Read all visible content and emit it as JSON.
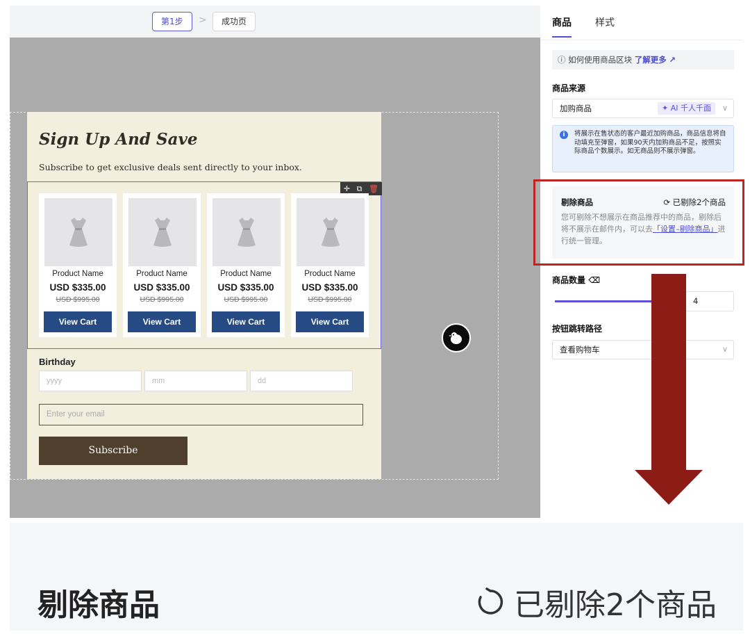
{
  "steps": {
    "step1": "第1步",
    "success": "成功页",
    "separator": ">"
  },
  "popup": {
    "title": "Sign Up And Save",
    "subtitle": "Subscribe to get exclusive deals sent directly to your inbox.",
    "products": [
      {
        "name": "Product Name",
        "price": "USD $335.00",
        "old_price": "USD $995.00",
        "button": "View Cart"
      },
      {
        "name": "Product Name",
        "price": "USD $335.00",
        "old_price": "USD $995.00",
        "button": "View Cart"
      },
      {
        "name": "Product Name",
        "price": "USD $335.00",
        "old_price": "USD $995.00",
        "button": "View Cart"
      },
      {
        "name": "Product Name",
        "price": "USD $335.00",
        "old_price": "USD $995.00",
        "button": "View Cart"
      }
    ],
    "birthday_label": "Birthday",
    "birthday_placeholders": {
      "year": "yyyy",
      "month": "mm",
      "day": "dd"
    },
    "email_placeholder": "Enter your email",
    "subscribe_label": "Subscribe"
  },
  "panel": {
    "tabs": {
      "products": "商品",
      "style": "样式"
    },
    "help_text": "如何使用商品区块",
    "help_link": "了解更多",
    "source_label": "商品来源",
    "source_value": "加购商品",
    "ai_badge": "AI 千人千面",
    "info_text": "将展示在售状态的客户最近加购商品，商品信息将自动填充至弹窗，如果90天内加购商品不足，按照实际商品个数展示。如无商品则不展示弹窗。",
    "remove_title": "剔除商品",
    "remove_count": "已剔除2个商品",
    "remove_desc_before": "您可剔除不想展示在商品推荐中的商品，剔除后将不展示在邮件内，可以去",
    "remove_desc_link": "「设置–剔除商品」",
    "remove_desc_after": "进行统一管理。",
    "quantity_label": "商品数量",
    "quantity_value": "4",
    "button_path_label": "按钮跳转路径",
    "button_path_value": "查看购物车"
  },
  "zoom": {
    "title": "剔除商品",
    "count": "已剔除2个商品"
  },
  "colors": {
    "accent": "#4f4dd0",
    "highlight_frame": "#bf2424",
    "arrow": "#8d1b16",
    "button_blue": "#264b84",
    "subscribe_brown": "#4f3f2d"
  },
  "icons": [
    "help-circle-icon",
    "external-link-icon",
    "sparkle-icon",
    "chevron-down-icon",
    "info-icon",
    "refresh-icon",
    "eraser-icon",
    "move-icon",
    "copy-icon",
    "trash-icon",
    "dress-icon"
  ]
}
